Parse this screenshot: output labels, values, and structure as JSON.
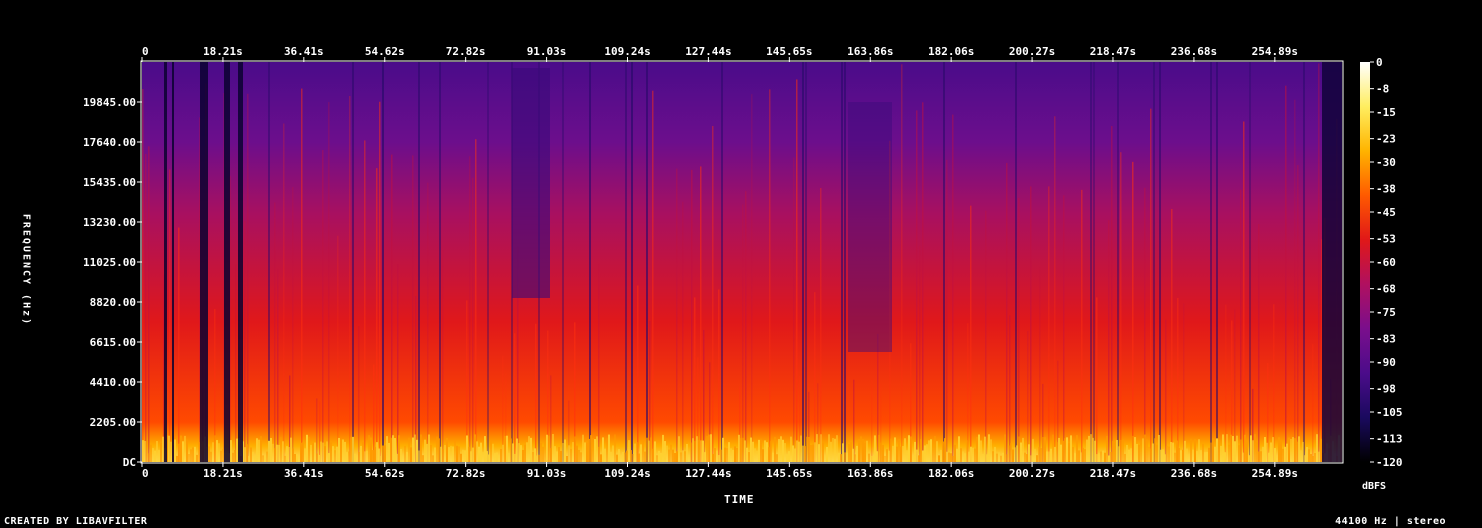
{
  "chart_data": {
    "type": "heatmap",
    "title": "",
    "xlabel": "TIME",
    "ylabel": "FREQUENCY (Hz)",
    "x_ticks": [
      "0",
      "18.21s",
      "36.41s",
      "54.62s",
      "72.82s",
      "91.03s",
      "109.24s",
      "127.44s",
      "145.65s",
      "163.86s",
      "182.06s",
      "200.27s",
      "218.47s",
      "236.68s",
      "254.89s"
    ],
    "x_tick_seconds": [
      0,
      18.21,
      36.41,
      54.62,
      72.82,
      91.03,
      109.24,
      127.44,
      145.65,
      163.86,
      182.06,
      200.27,
      218.47,
      236.68,
      254.89
    ],
    "x_range_seconds": [
      0,
      270
    ],
    "y_ticks": [
      "DC",
      "2205.00",
      "4410.00",
      "6615.00",
      "8820.00",
      "11025.00",
      "13230.00",
      "15435.00",
      "17640.00",
      "19845.00"
    ],
    "y_tick_hz": [
      0,
      2205,
      4410,
      6615,
      8820,
      11025,
      13230,
      15435,
      17640,
      19845
    ],
    "y_range_hz": [
      0,
      22050
    ],
    "colorbar": {
      "label": "dBFS",
      "ticks": [
        "0",
        "-8",
        "-15",
        "-23",
        "-30",
        "-38",
        "-45",
        "-53",
        "-60",
        "-68",
        "-75",
        "-83",
        "-90",
        "-98",
        "-105",
        "-113",
        "-120"
      ],
      "range_db": [
        -120,
        0
      ],
      "colors": [
        "#000000",
        "#1a0a5e",
        "#4b0c8a",
        "#7a0e8c",
        "#b01060",
        "#e01818",
        "#ff5a00",
        "#ffb400",
        "#ffee60",
        "#ffffff"
      ]
    },
    "notes": ""
  },
  "footer": {
    "left": "CREATED BY LIBAVFILTER",
    "right": "44100 Hz | stereo"
  }
}
